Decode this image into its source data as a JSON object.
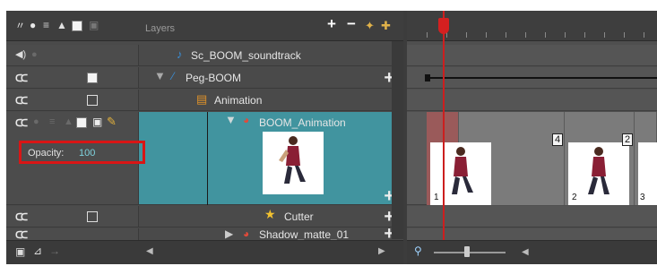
{
  "layers_header": {
    "title": "Layers",
    "add": "+",
    "remove": "−"
  },
  "layers": [
    {
      "name": "Sc_BOOM_soundtrack",
      "type": "sound"
    },
    {
      "name": "Peg-BOOM",
      "type": "peg"
    },
    {
      "name": "Animation",
      "type": "group"
    },
    {
      "name": "BOOM_Animation",
      "type": "drawing",
      "selected": true
    },
    {
      "name": "Cutter",
      "type": "effect"
    },
    {
      "name": "Shadow_matte_01",
      "type": "drawing"
    }
  ],
  "opacity": {
    "label": "Opacity:",
    "value": "100"
  },
  "timeline": {
    "frames": [
      {
        "number": "1"
      },
      {
        "number": "2"
      },
      {
        "number": "3"
      }
    ],
    "tags": [
      "4",
      "2"
    ]
  },
  "colors": {
    "selected_row": "#41949f",
    "highlight": "#d91515",
    "playhead": "#cc1f1f"
  }
}
